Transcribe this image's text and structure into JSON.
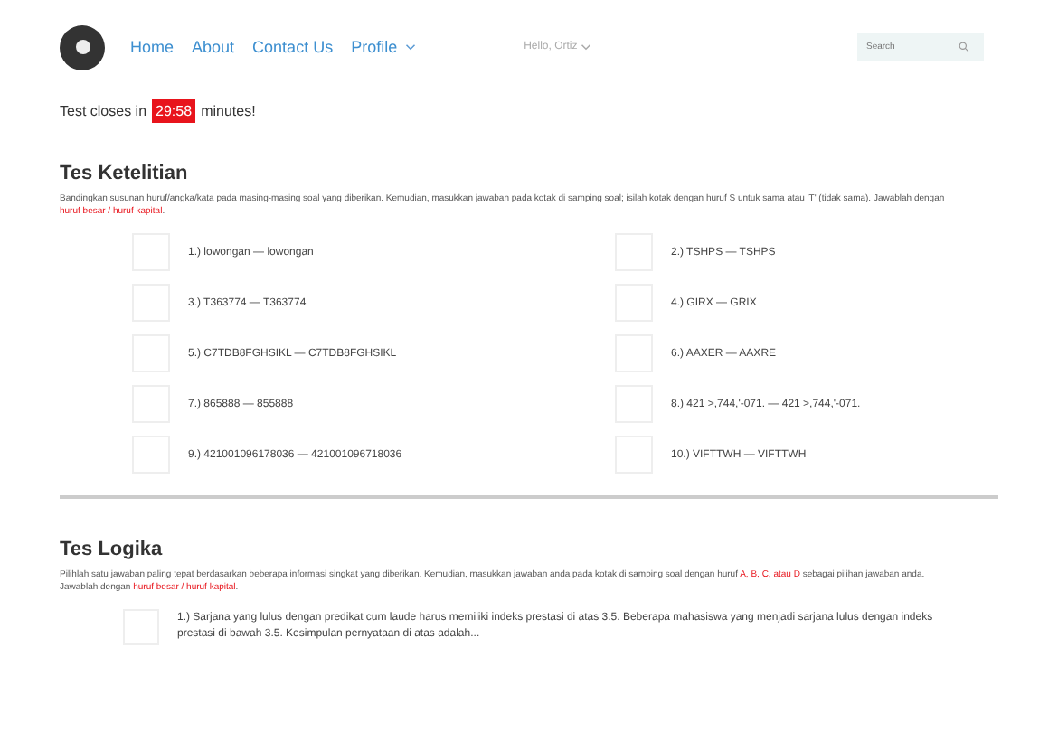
{
  "nav": {
    "links": [
      {
        "label": "Home",
        "dropdown": false
      },
      {
        "label": "About",
        "dropdown": false
      },
      {
        "label": "Contact Us",
        "dropdown": false
      },
      {
        "label": "Profile",
        "dropdown": true
      }
    ],
    "user": "Hello, Ortiz",
    "search": {
      "placeholder": "Search"
    }
  },
  "timer": {
    "before": "Test closes in",
    "time": "29:58",
    "after": "minutes!"
  },
  "sections": [
    {
      "title": "Tes Ketelitian",
      "instructions": "Bandingkan susunan huruf/angka/kata pada masing-masing soal yang diberikan. Kemudian, masukkan jawaban pada kotak di samping soal; isilah kotak dengan huruf S untuk sama atau 'T' (tidak sama). Jawablah dengan **huruf besar / huruf kapital**.",
      "kind": "grid",
      "questions": [
        {
          "text": "1.) lowongan — lowongan"
        },
        {
          "text": "2.) TSHPS — TSHPS"
        },
        {
          "text": "3.) T363774 — T363774"
        },
        {
          "text": "4.) GIRX — GRIX"
        },
        {
          "text": "5.) C7TDB8FGHSIKL — C7TDB8FGHSIKL"
        },
        {
          "text": "6.) AAXER — AAXRE"
        },
        {
          "text": "7.) 865888 — 855888"
        },
        {
          "text": "8.) 421 >,744,'-071. — 421 >,744,'-071."
        },
        {
          "text": "9.) 421001096178036 — 421001096718036"
        },
        {
          "text": "10.) VIFTTWH — VIFTTWH"
        }
      ]
    },
    {
      "title": "Tes Logika",
      "instructions": "Pilihlah satu jawaban paling tepat berdasarkan beberapa informasi singkat yang diberikan. Kemudian, masukkan jawaban anda pada kotak di samping soal dengan huruf **A, B, C, atau D** sebagai pilihan jawaban anda. Jawablah dengan **huruf besar / huruf kapital**.",
      "kind": "list",
      "questions": [
        {
          "text": "1.) Sarjana yang lulus dengan predikat cum laude harus memiliki indeks prestasi di atas 3.5. Beberapa mahasiswa yang menjadi sarjana lulus dengan indeks prestasi di bawah 3.5. Kesimpulan pernyataan di atas adalah..."
        }
      ]
    }
  ]
}
